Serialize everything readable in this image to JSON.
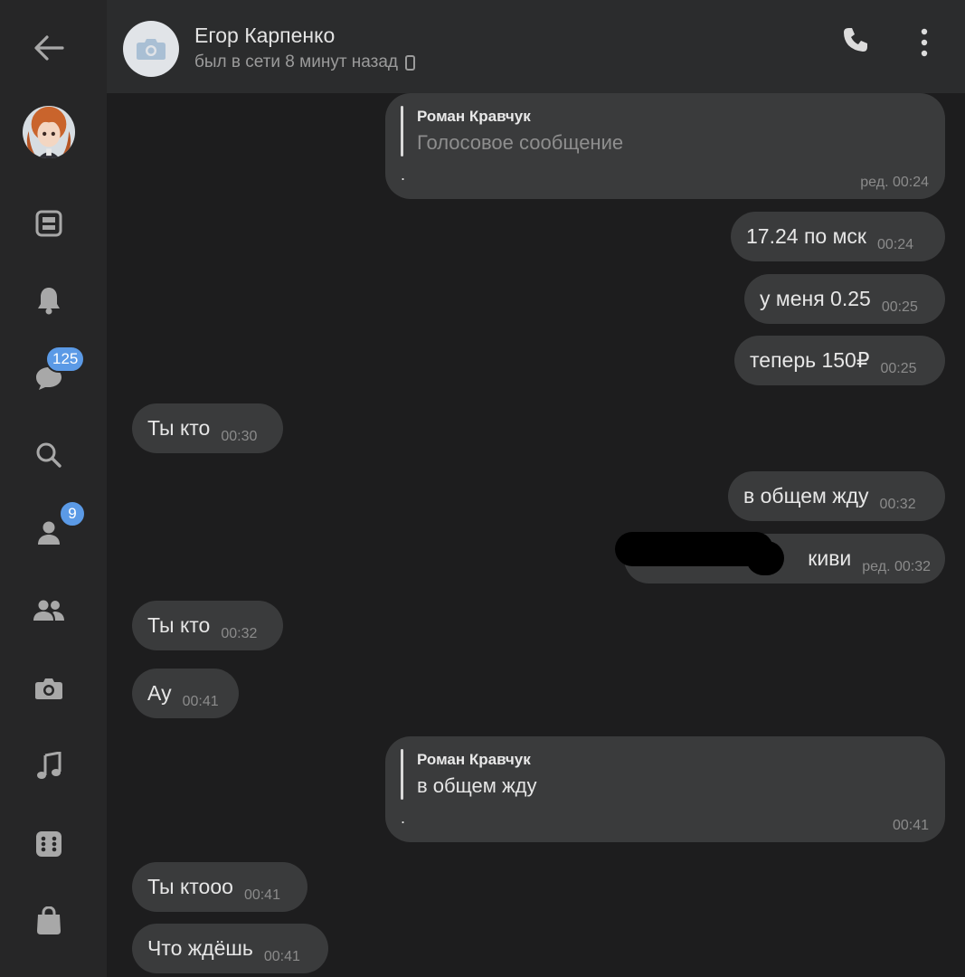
{
  "header": {
    "contact_name": "Егор Карпенко",
    "status": "был в сети 8 минут назад"
  },
  "sidebar": {
    "messages_badge": "125",
    "friends_badge": "9"
  },
  "messages": [
    {
      "side": "out",
      "type": "reply",
      "reply_author": "Роман Кравчук",
      "reply_text": "Голосовое сообщение",
      "text": ".",
      "time": "ред. 00:24"
    },
    {
      "side": "out",
      "text": "17.24 по мск",
      "time": "00:24"
    },
    {
      "side": "out",
      "text": "у меня 0.25",
      "time": "00:25"
    },
    {
      "side": "out",
      "text": "теперь 150₽",
      "time": "00:25"
    },
    {
      "side": "in",
      "text": "Ты кто",
      "time": "00:30"
    },
    {
      "side": "out",
      "text": "в общем жду",
      "time": "00:32"
    },
    {
      "side": "out",
      "text": "киви",
      "time": "ред. 00:32",
      "redacted": true
    },
    {
      "side": "in",
      "text": "Ты кто",
      "time": "00:32"
    },
    {
      "side": "in",
      "text": "Ау",
      "time": "00:41"
    },
    {
      "side": "out",
      "type": "reply",
      "reply_author": "Роман Кравчук",
      "reply_text": "в общем жду",
      "text": ".",
      "time": "00:41"
    },
    {
      "side": "in",
      "text": "Ты ктооо",
      "time": "00:41"
    },
    {
      "side": "in",
      "text": "Что ждёшь",
      "time": "00:41"
    }
  ],
  "colors": {
    "background": "#1d1d1e",
    "sidebar": "#262627",
    "header": "#2b2c2d",
    "bubble": "#3a3b3c",
    "badge": "#5b9ae6"
  },
  "icons": [
    "back-arrow-icon",
    "profile-avatar",
    "news-icon",
    "bell-icon",
    "chat-icon",
    "search-icon",
    "person-icon",
    "group-icon",
    "camera-icon",
    "music-icon",
    "apps-icon",
    "bag-icon",
    "phone-icon",
    "more-vertical-icon",
    "phone-device-icon"
  ]
}
